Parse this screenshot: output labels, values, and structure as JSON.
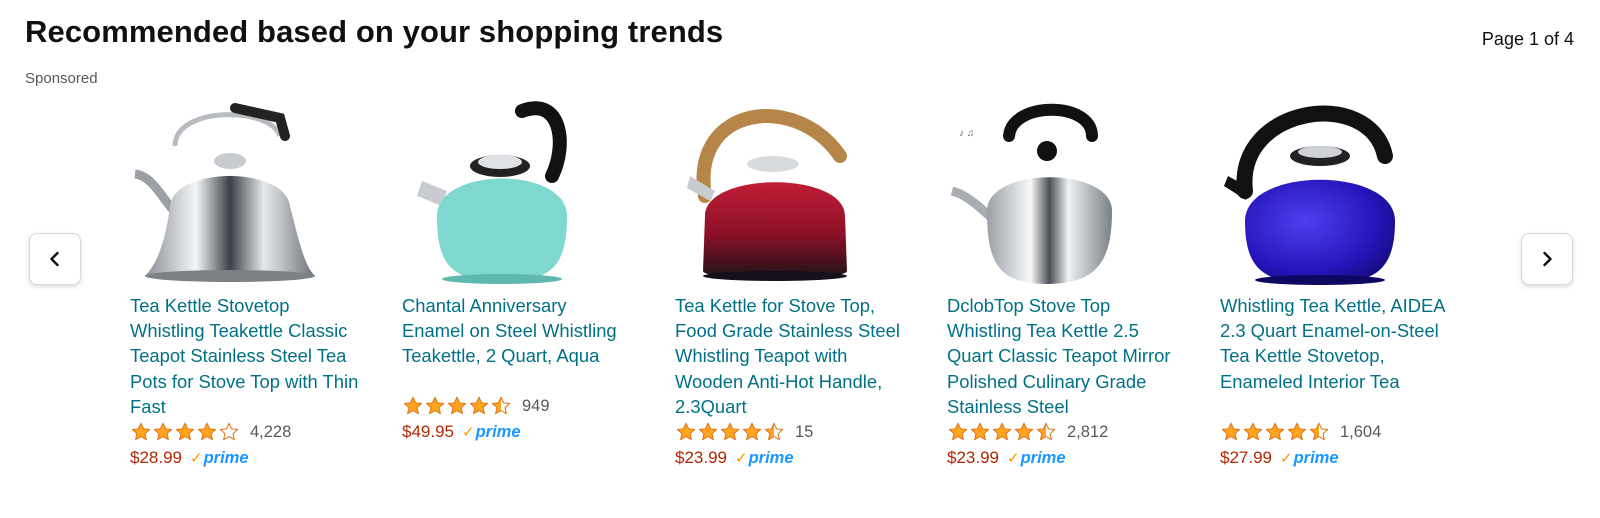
{
  "header": {
    "title": "Recommended based on your shopping trends",
    "page_indicator": "Page 1 of 4",
    "sponsored": "Sponsored"
  },
  "nav": {
    "prev_icon": "chevron-left-icon",
    "next_icon": "chevron-right-icon"
  },
  "prime_label": "prime",
  "colors": {
    "link": "#007185",
    "price": "#b12704",
    "star": "#ffa41c",
    "prime_blue": "#1a98ff",
    "prime_check": "#f59b00"
  },
  "products": [
    {
      "name": "Tea Kettle Stovetop Whistling Teakettle Classic Teapot Stainless Steel Tea Pots for Stove Top with Thin Fast",
      "rating": 4.0,
      "reviews": "4,228",
      "price": "$28.99",
      "prime": true,
      "image": "stainless-kettle-image"
    },
    {
      "name": "Chantal Anniversary Enamel on Steel Whistling Teakettle, 2 Quart, Aqua",
      "rating": 4.5,
      "reviews": "949",
      "price": "$49.95",
      "prime": true,
      "image": "aqua-kettle-image"
    },
    {
      "name": "Tea Kettle for Stove Top, Food Grade Stainless Steel Whistling Teapot with Wooden Anti-Hot Handle, 2.3Quart",
      "rating": 4.5,
      "reviews": "15",
      "price": "$23.99",
      "prime": true,
      "image": "red-kettle-image"
    },
    {
      "name": "DclobTop Stove Top Whistling Tea Kettle 2.5 Quart Classic Teapot Mirror Polished Culinary Grade Stainless Steel",
      "rating": 4.5,
      "reviews": "2,812",
      "price": "$23.99",
      "prime": true,
      "image": "mirror-kettle-image"
    },
    {
      "name": "Whistling Tea Kettle, AIDEA 2.3 Quart Enamel-on-Steel Tea Kettle Stovetop, Enameled Interior Tea",
      "rating": 4.5,
      "reviews": "1,604",
      "price": "$27.99",
      "prime": true,
      "image": "blue-kettle-image"
    }
  ]
}
